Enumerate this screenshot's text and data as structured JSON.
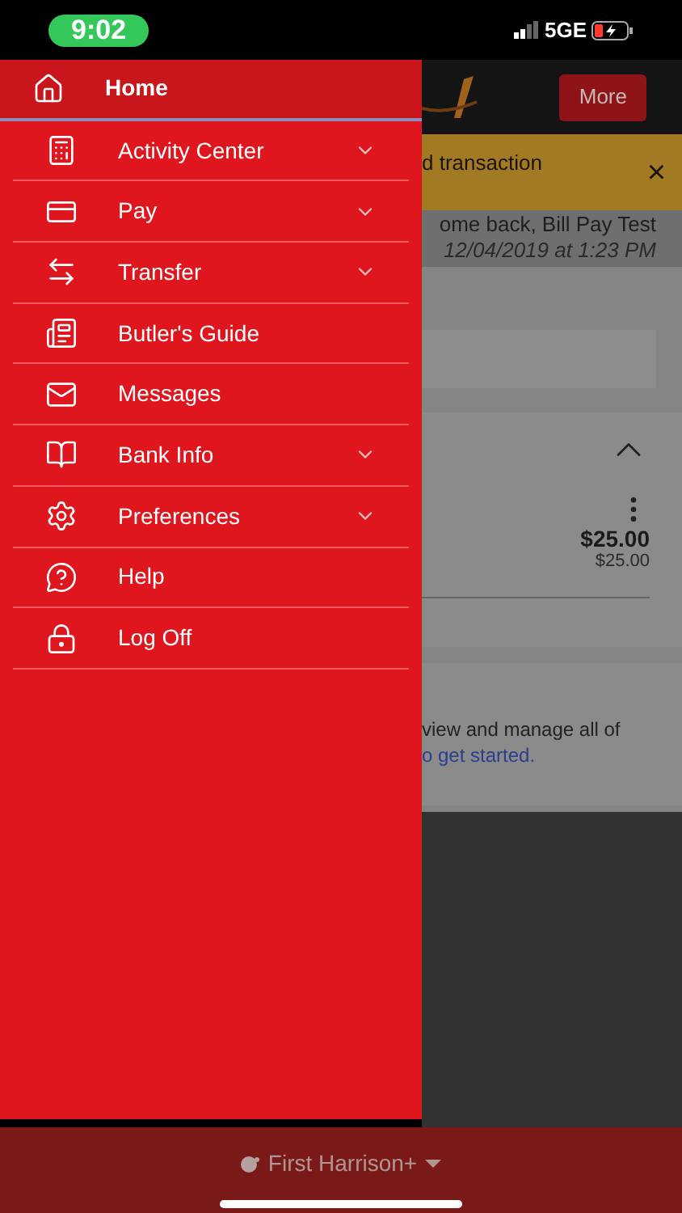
{
  "status_bar": {
    "time": "9:02",
    "network": "5GE"
  },
  "drawer": {
    "items": [
      {
        "label": "Home",
        "selected": true,
        "expandable": false
      },
      {
        "label": "Activity Center",
        "selected": false,
        "expandable": true
      },
      {
        "label": "Pay",
        "selected": false,
        "expandable": true
      },
      {
        "label": "Transfer",
        "selected": false,
        "expandable": true
      },
      {
        "label": "Butler's Guide",
        "selected": false,
        "expandable": false
      },
      {
        "label": "Messages",
        "selected": false,
        "expandable": false
      },
      {
        "label": "Bank Info",
        "selected": false,
        "expandable": true
      },
      {
        "label": "Preferences",
        "selected": false,
        "expandable": true
      },
      {
        "label": "Help",
        "selected": false,
        "expandable": false
      },
      {
        "label": "Log Off",
        "selected": false,
        "expandable": false
      }
    ]
  },
  "header": {
    "more_button": "More"
  },
  "banner": {
    "text": "d transaction",
    "close": "×"
  },
  "greeting": {
    "text": "ome back, Bill Pay Test",
    "last_login": "12/04/2019 at 1:23 PM"
  },
  "account_card": {
    "expanded": true,
    "amount": "$25.00",
    "available": "$25.00"
  },
  "info_card": {
    "text": "view and manage all of",
    "link": "o get started."
  },
  "bottom_bar": {
    "label": "First Harrison+"
  }
}
